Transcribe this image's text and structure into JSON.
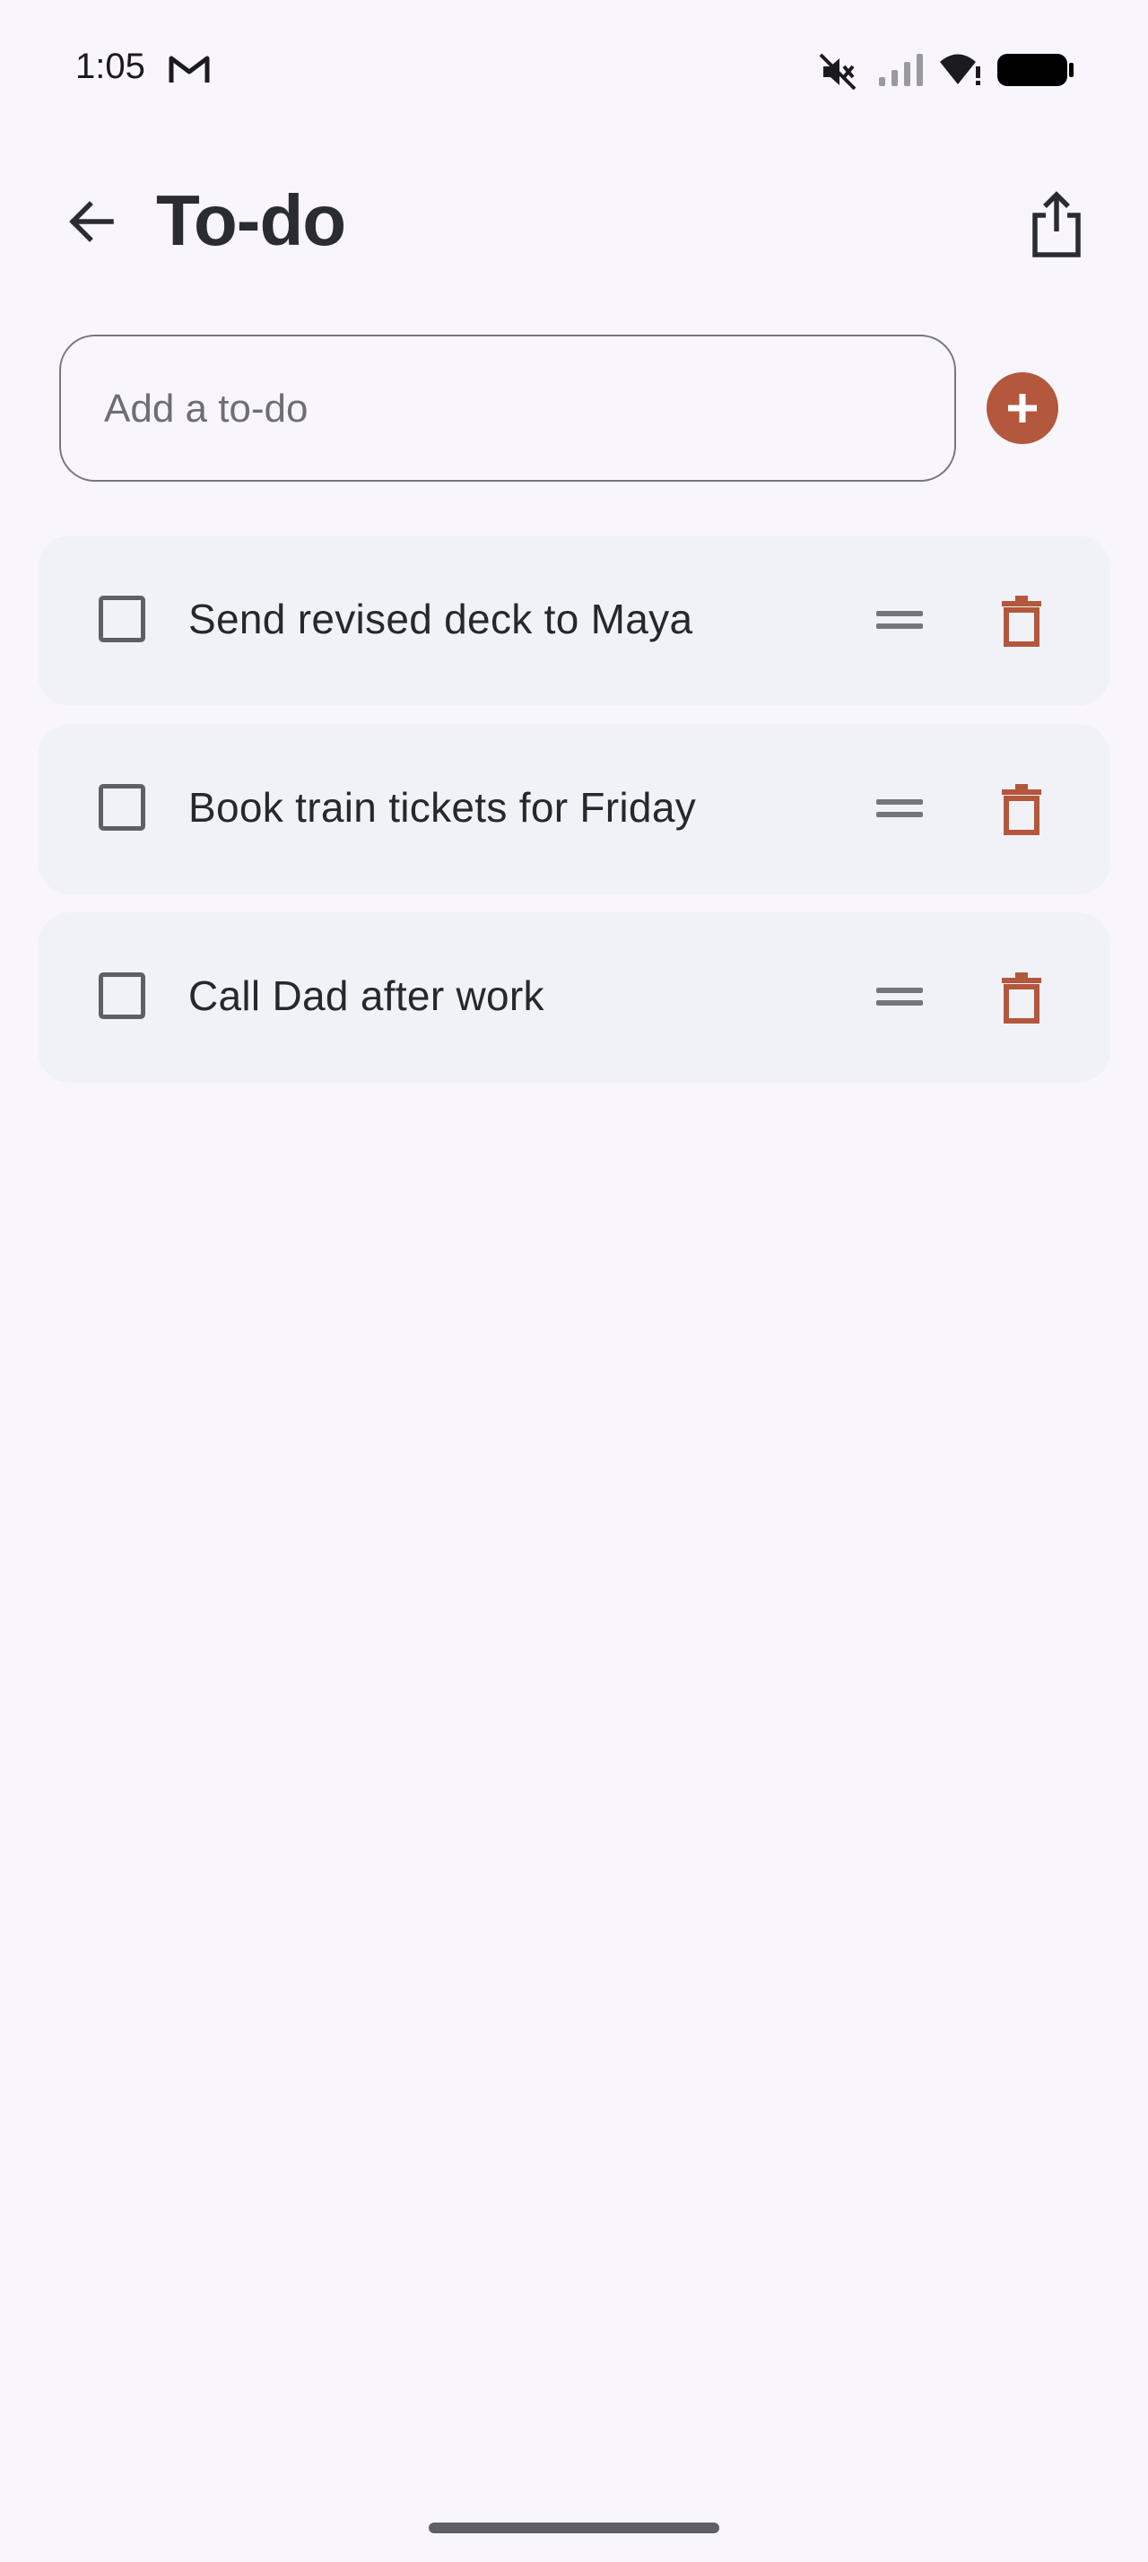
{
  "status_bar": {
    "time": "1:05",
    "icons": [
      "gmail-icon",
      "mute-icon",
      "signal-icon",
      "wifi-icon",
      "battery-icon"
    ]
  },
  "header": {
    "title": "To-do",
    "back_icon": "back-arrow-icon",
    "share_icon": "share-icon"
  },
  "add_todo": {
    "placeholder": "Add a to-do",
    "value": "",
    "add_button_icon": "plus-icon"
  },
  "todos": [
    {
      "label": "Send revised deck to Maya",
      "checked": false
    },
    {
      "label": "Book train tickets for Friday",
      "checked": false
    },
    {
      "label": "Call Dad after work",
      "checked": false
    }
  ],
  "colors": {
    "accent": "#b3573d",
    "background": "#f8f6fc",
    "card": "#f1f2f7",
    "text": "#26282c"
  }
}
